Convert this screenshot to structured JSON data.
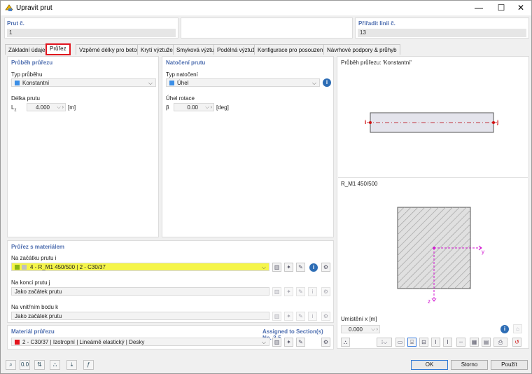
{
  "window": {
    "title": "Upravit prut",
    "minimize": "—",
    "maximize": "☐",
    "close": "✕"
  },
  "header": {
    "member_label": "Prut č.",
    "member_value": "1",
    "line_label": "Přiřadit linii č.",
    "line_value": "13"
  },
  "tabs": [
    {
      "label": "Základní údaje"
    },
    {
      "label": "Průřez"
    },
    {
      "label": "Vzpěrné délky pro beton"
    },
    {
      "label": "Krytí výztuže"
    },
    {
      "label": "Smyková výztuž"
    },
    {
      "label": "Podélná výztuž"
    },
    {
      "label": "Konfigurace pro posouzení"
    },
    {
      "label": "Návrhové podpory & průhyb"
    }
  ],
  "profile": {
    "title": "Průběh průřezu",
    "type_label": "Typ průběhu",
    "type_value": "Konstantní",
    "type_color": "#3b8ee6",
    "length_label": "Délka prutu",
    "length_symbol": "L",
    "length_sub": "z",
    "length_value": "4.000",
    "length_unit": "[m]"
  },
  "rotation": {
    "title": "Natočení prutu",
    "type_label": "Typ natočení",
    "type_value": "Úhel",
    "type_color": "#3b8ee6",
    "angle_label": "Úhel rotace",
    "angle_symbol": "β",
    "angle_value": "0.00",
    "angle_unit": "[deg]"
  },
  "cross_sections": {
    "title": "Průřez s materiálem",
    "start_label": "Na začátku prutu i",
    "start_value": "4 - R_M1 450/500 | 2 - C30/37",
    "start_color": "#8ab416",
    "start_color2": "#c0c0c0",
    "end_label": "Na konci prutu j",
    "end_value": "Jako začátek prutu",
    "inner_label": "Na vnitřním bodu k",
    "inner_value": "Jako začátek prutu"
  },
  "material": {
    "title": "Materiál průřezu",
    "assigned": "Assigned to Section(s) No. 3-5",
    "value": "2 - C30/37 | Izotropní | Lineárně elastický | Desky",
    "color": "#e3141e"
  },
  "preview": {
    "profile_title": "Průběh průřezu: 'Konstantní'",
    "node_i": "i",
    "node_j": "j",
    "section_name": "R_M1 450/500",
    "axis_y": "y",
    "axis_z": "z",
    "position_label": "Umístění x [m]",
    "position_value": "0.000"
  },
  "footer": {
    "ok": "OK",
    "cancel": "Storno",
    "apply": "Použít"
  }
}
